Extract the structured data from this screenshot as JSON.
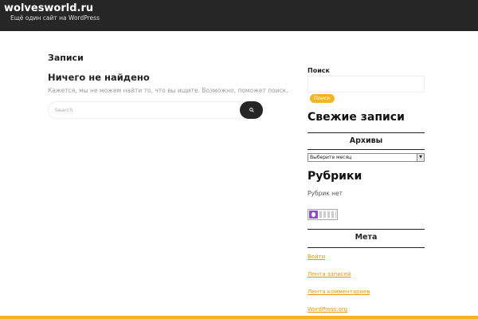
{
  "header": {
    "site_title": "wolvesworld.ru",
    "site_description": "Ещё один сайт на WordPress"
  },
  "main": {
    "page_title": "Записи",
    "not_found_title": "Ничего не найдено",
    "not_found_text": "Кажется, мы не можем найти то, что вы ищите. Возможно, поможет поиск.",
    "search_placeholder": "Search",
    "search_button_icon": "magnifier-icon"
  },
  "sidebar": {
    "search_label": "Поиск",
    "search_button": "Поиск",
    "recent_posts_title": "Свежие записи",
    "archives_title": "Архивы",
    "archives_select_value": "Выберите месяц",
    "categories_title": "Рубрики",
    "categories_empty": "Рубрик нет",
    "meta_title": "Мета",
    "meta_links": [
      "Войти",
      "Лента записей",
      "Лента комментариев",
      "WordPress.org"
    ]
  },
  "colors": {
    "header_bg": "#262626",
    "accent": "#f0b520",
    "link": "#e09a00"
  }
}
